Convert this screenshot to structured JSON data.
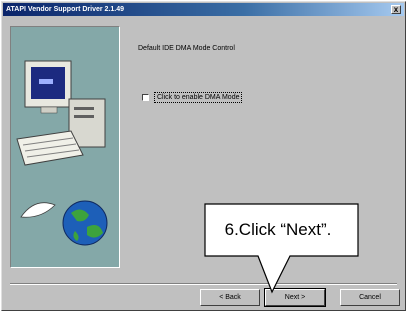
{
  "window": {
    "title": "ATAPI Vendor Support Driver 2.1.49",
    "close_glyph": "x"
  },
  "main": {
    "heading": "Default IDE DMA Mode Control",
    "checkbox_label": "Click to enable DMA Mode",
    "checkbox_checked": false
  },
  "buttons": {
    "back": "< Back",
    "next": "Next >",
    "cancel": "Cancel"
  },
  "callout": {
    "text": "6.Click “Next”."
  },
  "icons": {
    "illustration": "computer-with-globe-illustration",
    "close": "close-icon"
  }
}
